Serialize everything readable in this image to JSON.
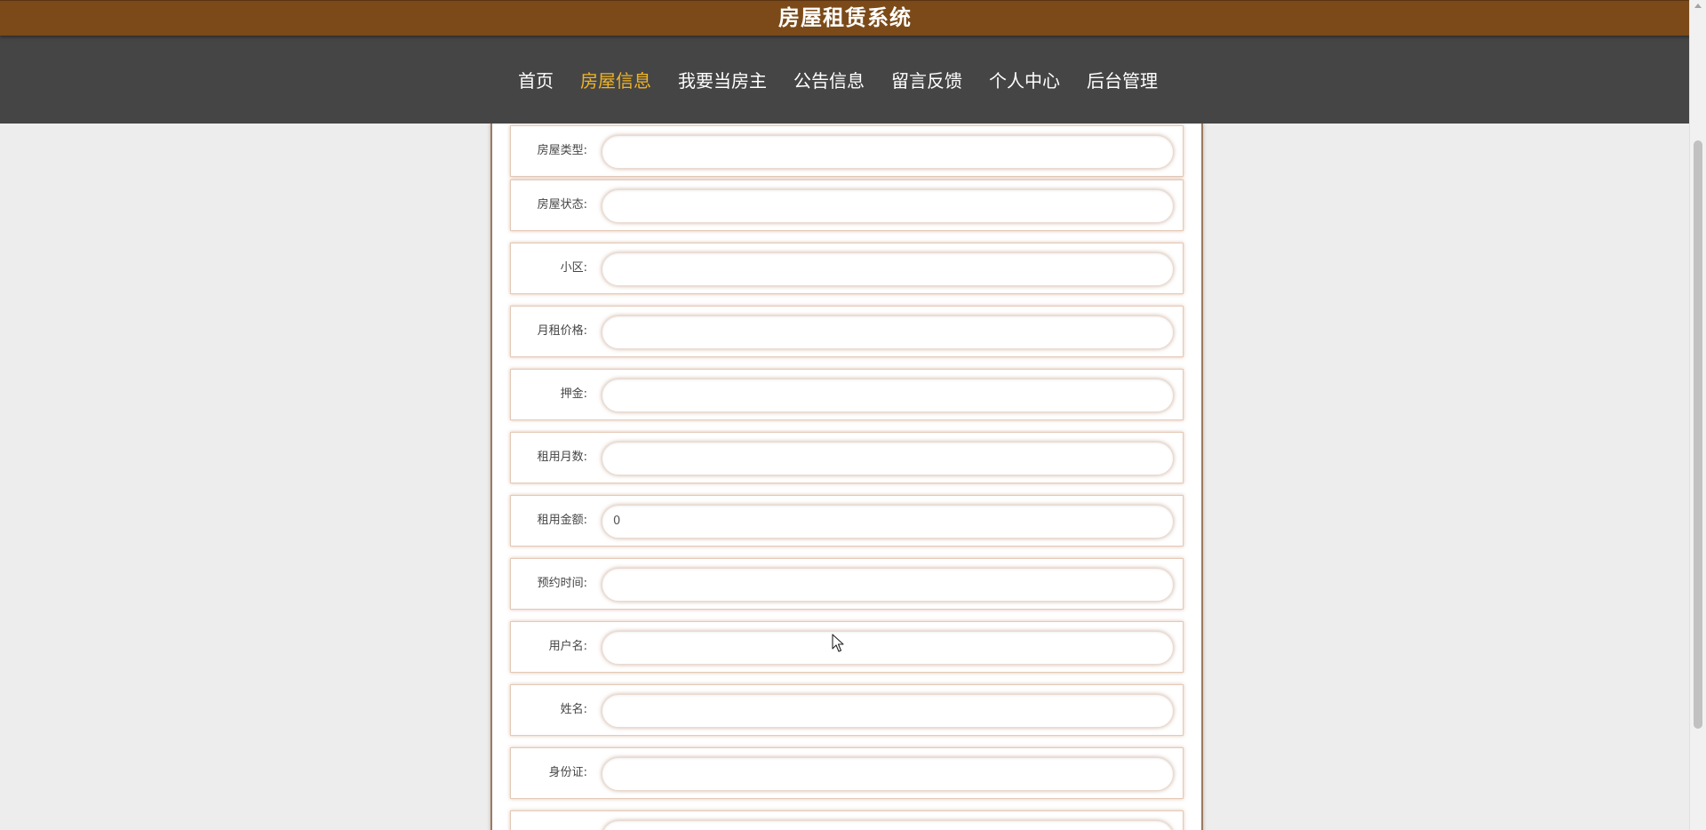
{
  "header": {
    "title": "房屋租赁系统"
  },
  "nav": {
    "items": [
      {
        "label": "首页",
        "active": false
      },
      {
        "label": "房屋信息",
        "active": true
      },
      {
        "label": "我要当房主",
        "active": false
      },
      {
        "label": "公告信息",
        "active": false
      },
      {
        "label": "留言反馈",
        "active": false
      },
      {
        "label": "个人中心",
        "active": false
      },
      {
        "label": "后台管理",
        "active": false
      }
    ],
    "active_color": "#f0b428"
  },
  "form": {
    "fields": [
      {
        "label": "房屋类型:",
        "value": ""
      },
      {
        "label": "房屋状态:",
        "value": ""
      },
      {
        "label": "小区:",
        "value": ""
      },
      {
        "label": "月租价格:",
        "value": ""
      },
      {
        "label": "押金:",
        "value": ""
      },
      {
        "label": "租用月数:",
        "value": ""
      },
      {
        "label": "租用金额:",
        "value": "0"
      },
      {
        "label": "预约时间:",
        "value": ""
      },
      {
        "label": "用户名:",
        "value": ""
      },
      {
        "label": "姓名:",
        "value": ""
      },
      {
        "label": "身份证:",
        "value": ""
      },
      {
        "label": "",
        "value": ""
      }
    ]
  },
  "colors": {
    "title_bar": "#7b4a18",
    "nav_bar": "#454545",
    "page_bg": "#ededed"
  }
}
